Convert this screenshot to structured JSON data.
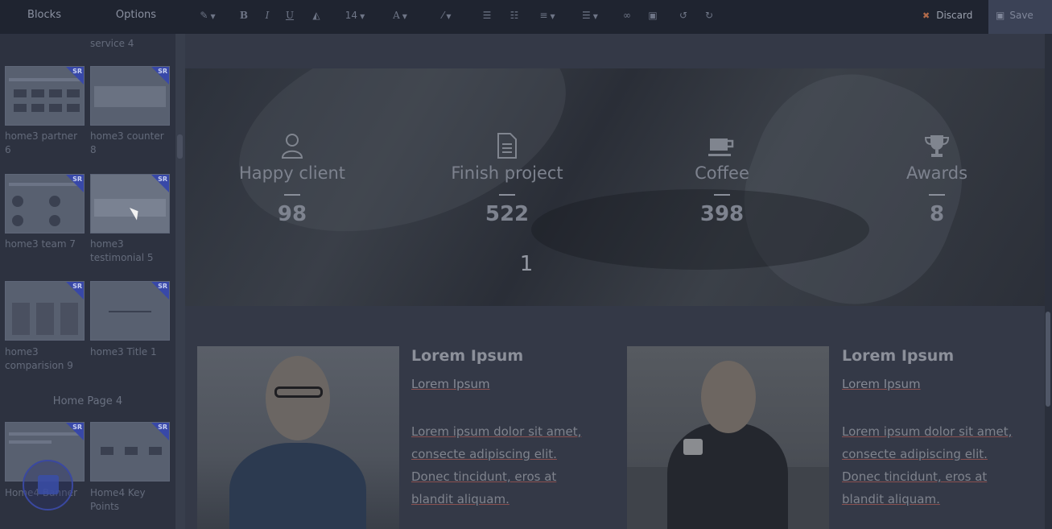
{
  "toolbar": {
    "tabs": [
      "Blocks",
      "Options"
    ],
    "font_size": "14",
    "discard_label": "Discard",
    "save_label": "Save"
  },
  "sidebar": {
    "partial_label_top": "service 4",
    "blocks": [
      {
        "label": "home3 partner 6"
      },
      {
        "label": "home3 counter 8"
      },
      {
        "label": "home3 team 7"
      },
      {
        "label": "home3 testimonial 5"
      },
      {
        "label": "home3 comparision 9"
      },
      {
        "label": "home3 Title 1"
      },
      {
        "label": "Home4 Banner"
      },
      {
        "label": "Home4 Key Points"
      }
    ],
    "group_title": "Home Page 4",
    "badge": "SR"
  },
  "counters": [
    {
      "name": "Happy client",
      "value": "98",
      "icon": "user-icon"
    },
    {
      "name": "Finish project",
      "value": "522",
      "icon": "document-icon"
    },
    {
      "name": "Coffee",
      "value": "398",
      "icon": "coffee-icon"
    },
    {
      "name": "Awards",
      "value": "8",
      "icon": "trophy-icon"
    }
  ],
  "pager": "1",
  "cards": [
    {
      "title": "Lorem Ipsum",
      "subtitle": "Lorem Ipsum",
      "text_lines": [
        "Lorem ipsum dolor sit amet,",
        "consecte adipiscing elit.",
        "Donec tincidunt, eros at",
        "blandit aliquam."
      ]
    },
    {
      "title": "Lorem Ipsum",
      "subtitle": "Lorem Ipsum",
      "text_lines": [
        "Lorem ipsum dolor sit amet,",
        "consecte adipiscing elit.",
        "Donec tincidunt, eros at",
        "blandit aliquam."
      ]
    }
  ]
}
